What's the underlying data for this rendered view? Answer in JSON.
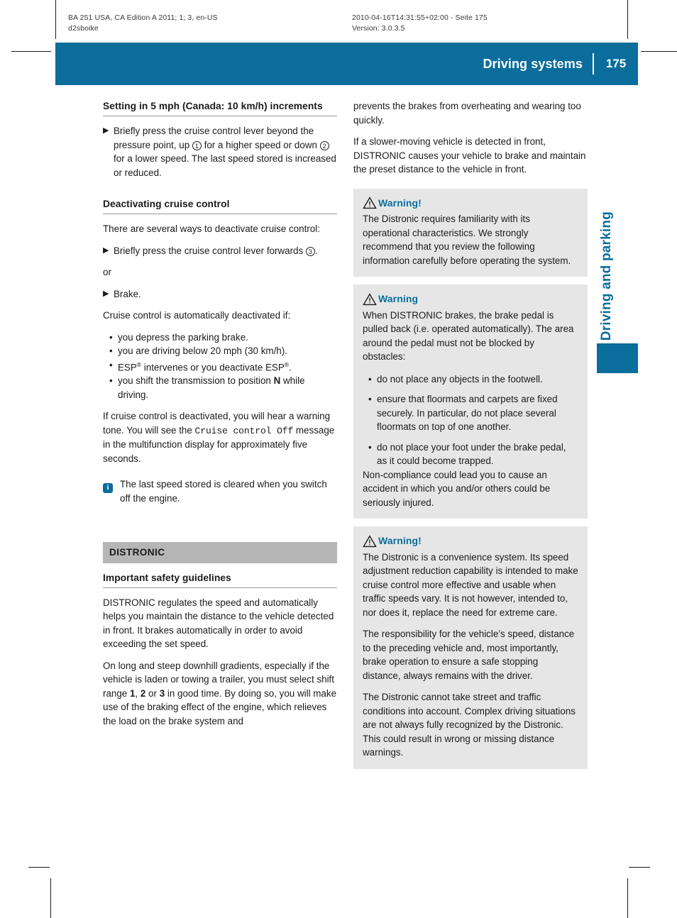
{
  "prepress": {
    "left_line1": "BA 251 USA, CA Edition A 2011; 1; 3, en-US",
    "left_line2": "d2sboike",
    "right_line1": "2010-04-16T14:31:55+02:00 - Seite 175",
    "right_line2": "Version: 3.0.3.5"
  },
  "running_head": {
    "chapter_title": "Driving systems",
    "page_number": "175",
    "accent_color": "#0a6d9c"
  },
  "thumb_tab": {
    "label": "Driving and parking",
    "color": "#0a6d9c"
  },
  "left_column": {
    "heading_1": "Setting in 5 mph (Canada: 10 km/h) increments",
    "step_1": {
      "marker": "▶",
      "text_a": "Briefly press the cruise control lever beyond the pressure point, up ",
      "circled_1": "1",
      "text_b": " for a higher speed or down ",
      "circled_2": "2",
      "text_c": " for a lower speed. The last speed stored is increased or reduced."
    },
    "heading_2": "Deactivating cruise control",
    "paragraph_1": "There are several ways to deactivate cruise control:",
    "step_2": {
      "marker": "▶",
      "text_a": "Briefly press the cruise control lever forwards ",
      "circled_3": "3",
      "text_b": "."
    },
    "or_label": "or",
    "step_3": {
      "marker": "▶",
      "text": "Brake."
    },
    "paragraph_2": "Cruise control is automatically deactivated if:",
    "bullets": [
      {
        "marker": "•",
        "text": "you depress the parking brake."
      },
      {
        "marker": "•",
        "text": "you are driving below 20 mph (30 km/h)."
      },
      {
        "marker": "•",
        "text_pre": "ESP",
        "sup_1": "®",
        "text_mid": " intervenes or you deactivate ESP",
        "sup_2": "®",
        "text_post": "."
      },
      {
        "marker": "•",
        "text_pre": "you shift the transmission to position ",
        "bold": "N",
        "text_post": " while driving."
      }
    ],
    "paragraph_3a": "If cruise control is deactivated, you will hear a warning tone. You will see the ",
    "paragraph_3_mono": "Cruise control Off",
    "paragraph_3b": " message in the multifunction display for approximately five seconds.",
    "note": {
      "icon": "info-icon",
      "glyph": "i",
      "text": "The last speed stored is cleared when you switch off the engine."
    },
    "section_band": "DISTRONIC",
    "heading_3": "Important safety guidelines",
    "paragraph_4": "DISTRONIC regulates the speed and automatically helps you maintain the distance to the vehicle detected in front. It brakes automatically in order to avoid exceeding the set speed.",
    "paragraph_5a": "On long and steep downhill gradients, especially if the vehicle is laden or towing a trailer, you must select shift range ",
    "paragraph_5_r1": "1",
    "paragraph_5_sep1": ", ",
    "paragraph_5_r2": "2",
    "paragraph_5_sep2": " or ",
    "paragraph_5_r3": "3",
    "paragraph_5b": " in good time. By doing so, you will make use of the braking effect of the engine, which relieves the load on the brake system and"
  },
  "right_column": {
    "paragraph_1": "prevents the brakes from overheating and wearing too quickly.",
    "paragraph_2": "If a slower-moving vehicle is detected in front, DISTRONIC causes your vehicle to brake and maintain the preset distance to the vehicle in front.",
    "warning_1": {
      "icon": "warning-triangle-icon",
      "title": "Warning!",
      "paragraphs": [
        "The Distronic requires familiarity with its operational characteristics. We strongly recommend that you review the following information carefully before operating the system."
      ]
    },
    "warning_2": {
      "icon": "warning-triangle-icon",
      "title": "Warning",
      "intro": "When DISTRONIC brakes, the brake pedal is pulled back (i.e. operated automatically). The area around the pedal must not be blocked by obstacles:",
      "bullets": [
        {
          "marker": "•",
          "text": "do not place any objects in the footwell."
        },
        {
          "marker": "•",
          "text": "ensure that floormats and carpets are fixed securely. In particular, do not place several floormats on top of one another."
        },
        {
          "marker": "•",
          "text": "do not place your foot under the brake pedal, as it could become trapped."
        }
      ],
      "outro": "Non-compliance could lead you to cause an accident in which you and/or others could be seriously injured."
    },
    "warning_3": {
      "icon": "warning-triangle-icon",
      "title": "Warning!",
      "paragraphs": [
        "The Distronic is a convenience system. Its speed adjustment reduction capability is intended to make cruise control more effective and usable when traffic speeds vary. It is not however, intended to, nor does it, replace the need for extreme care.",
        "The responsibility for the vehicle’s speed, distance to the preceding vehicle and, most importantly, brake operation to ensure a safe stopping distance, always remains with the driver.",
        "The Distronic cannot take street and traffic conditions into account. Complex driving situations are not always fully recognized by the Distronic. This could result in wrong or missing distance warnings."
      ]
    }
  }
}
